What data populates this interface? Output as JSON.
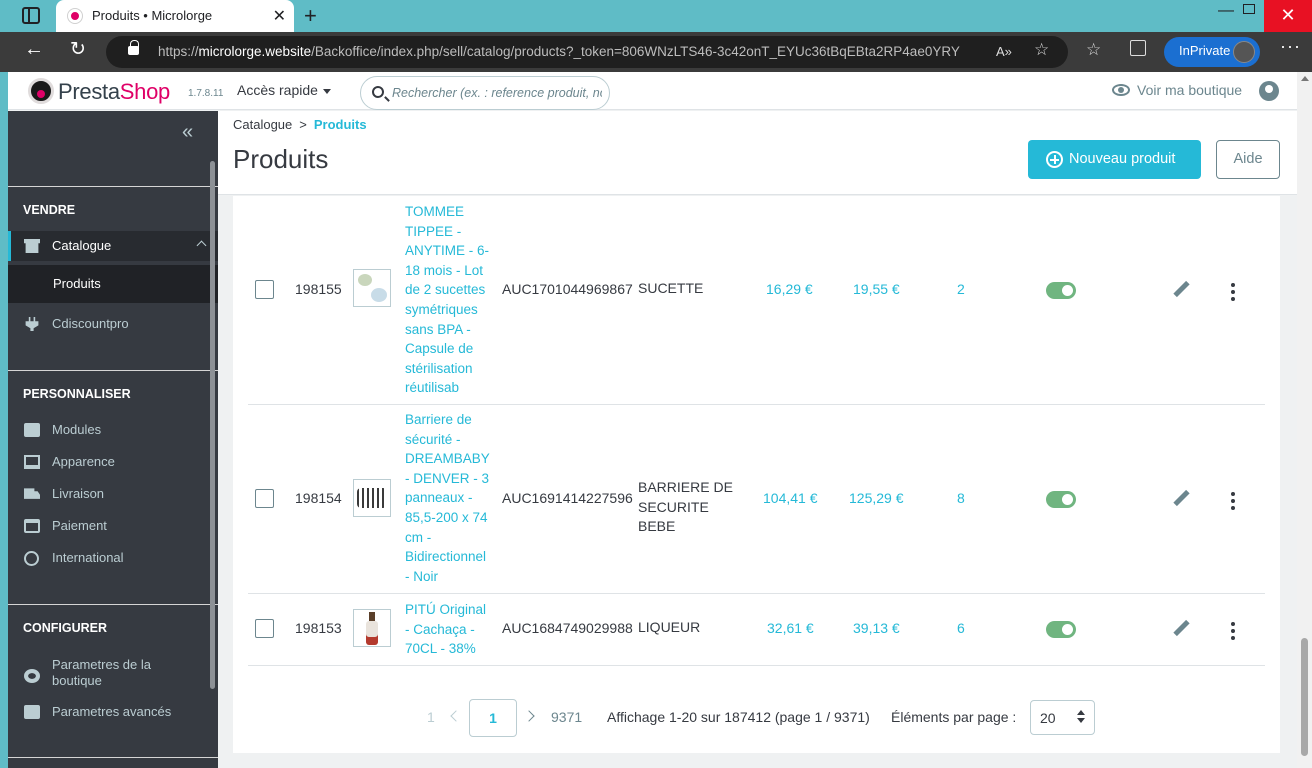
{
  "browser": {
    "tab_title": "Produits • Microlorge",
    "url_prefix": "https://",
    "url_domain": "microlorge.website",
    "url_path": "/Backoffice/index.php/sell/catalog/products?_token=806WNzLTS46-3c42onT_EYUc36tBqEBta2RP4ae0YRY",
    "inprivate_label": "InPrivate"
  },
  "header": {
    "logo_text_a": "Presta",
    "logo_text_b": "Shop",
    "version": "1.7.8.11",
    "quick_access": "Accès rapide",
    "search_placeholder": "Rechercher (ex. : reference produit, no",
    "view_shop": "Voir ma boutique"
  },
  "sidebar": {
    "sections": [
      {
        "title": "VENDRE"
      },
      {
        "title": "PERSONNALISER"
      },
      {
        "title": "CONFIGURER"
      }
    ],
    "items": {
      "catalogue": "Catalogue",
      "produits": "Produits",
      "cdiscountpro": "Cdiscountpro",
      "modules": "Modules",
      "apparence": "Apparence",
      "livraison": "Livraison",
      "paiement": "Paiement",
      "international": "International",
      "parametres_boutique": "Parametres de la boutique",
      "parametres_avances": "Parametres avancés"
    }
  },
  "toolbar": {
    "breadcrumb_parent": "Catalogue",
    "breadcrumb_sep": ">",
    "breadcrumb_current": "Produits",
    "title": "Produits",
    "new_product": "Nouveau produit",
    "help": "Aide"
  },
  "products": [
    {
      "id": "198155",
      "name": "TOMMEE TIPPEE - ANYTIME - 6-18 mois - Lot de 2 sucettes symétriques sans BPA - Capsule de stérilisation réutilisab",
      "reference": "AUC1701044969867",
      "category": "SUCETTE",
      "price_ht": "16,29 €",
      "price_ttc": "19,55 €",
      "quantity": "2",
      "active": true
    },
    {
      "id": "198154",
      "name": "Barriere de sécurité - DREAMBABY - DENVER - 3 panneaux - 85,5-200 x 74 cm - Bidirectionnel - Noir",
      "reference": "AUC1691414227596",
      "category": "BARRIERE DE SECURITE BEBE",
      "price_ht": "104,41 €",
      "price_ttc": "125,29 €",
      "quantity": "8",
      "active": true
    },
    {
      "id": "198153",
      "name": "PITÚ Original - Cachaça - 70CL - 38%",
      "reference": "AUC1684749029988",
      "category": "LIQUEUR",
      "price_ht": "32,61 €",
      "price_ttc": "39,13 €",
      "quantity": "6",
      "active": true
    }
  ],
  "pagination": {
    "first": "1",
    "current": "1",
    "last": "9371",
    "info": "Affichage 1-20 sur 187412 (page 1 / 9371)",
    "per_page_label": "Éléments par page :",
    "per_page_value": "20"
  },
  "colors": {
    "accent": "#25b9d7",
    "sidebar_bg": "#363a41",
    "toggle_on": "#70b580",
    "brand_pink": "#df0067"
  }
}
